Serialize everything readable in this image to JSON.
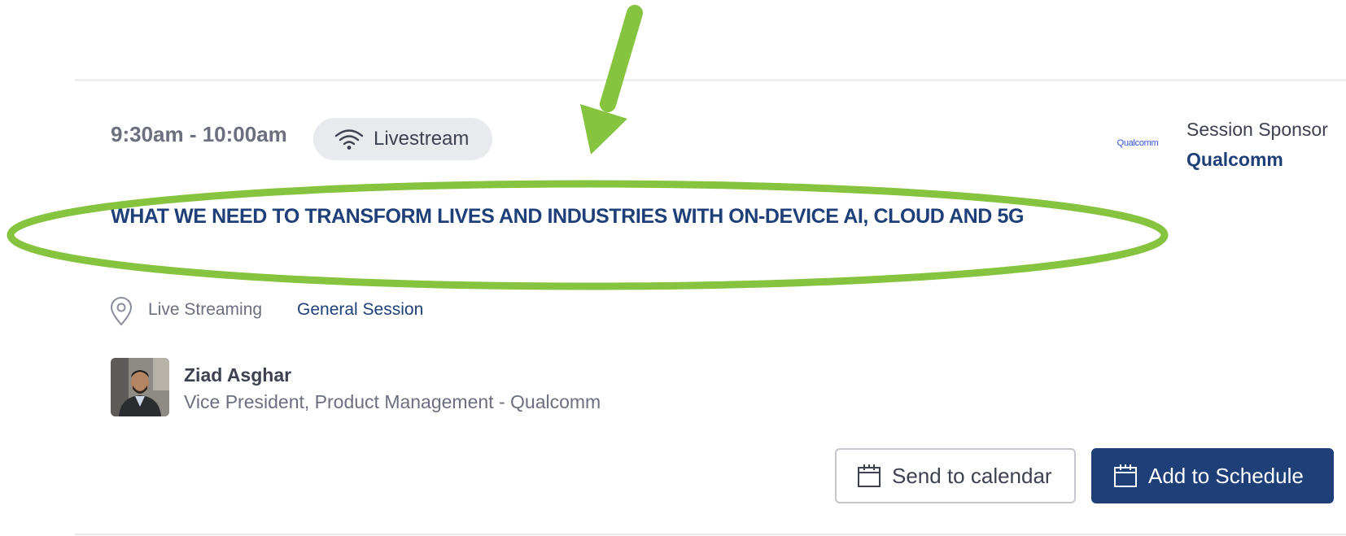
{
  "session": {
    "time": "9:30am - 10:00am",
    "badge_label": "Livestream",
    "title": "WHAT WE NEED TO TRANSFORM LIVES AND INDUSTRIES WITH ON-DEVICE AI, CLOUD AND 5G",
    "location": "Live Streaming",
    "track": "General Session"
  },
  "sponsor": {
    "label": "Session Sponsor",
    "name": "Qualcomm",
    "logo_text": "Qualcomm"
  },
  "speaker": {
    "name": "Ziad Asghar",
    "role": "Vice President, Product Management  - Qualcomm"
  },
  "actions": {
    "send_calendar_label": "Send to calendar",
    "add_schedule_label": "Add to Schedule"
  },
  "icons": {
    "badge": "wifi-icon",
    "location": "map-pin-icon",
    "calendar": "calendar-icon"
  },
  "annotations": {
    "arrow": "green-arrow",
    "highlight": "green-oval"
  },
  "colors": {
    "accent_navy": "#1e3f78",
    "annotation_green": "#86c440",
    "muted_text": "#6b6f7e",
    "pill_bg": "#e9eaee",
    "sponsor_blue": "#3253dc"
  }
}
